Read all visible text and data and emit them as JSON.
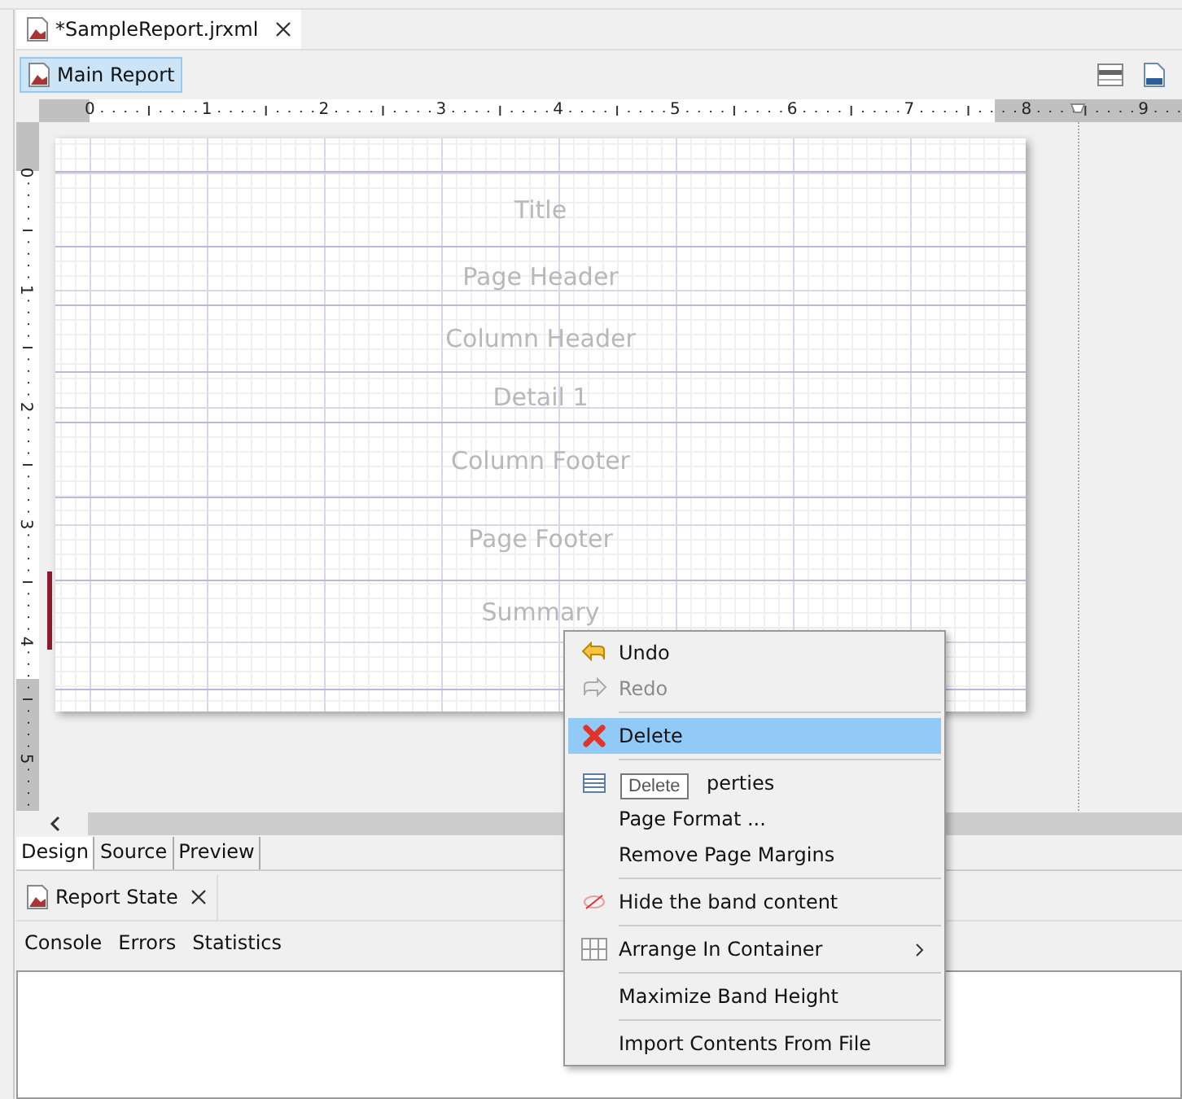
{
  "editor_tabs": [
    {
      "label": "*SampleReport.jrxml",
      "selected": true
    }
  ],
  "breadcrumb": {
    "label": "Main Report",
    "selected": true
  },
  "horizontal_ruler": {
    "labels": [
      "0",
      "1",
      "2",
      "3",
      "4",
      "5",
      "6",
      "7",
      "8",
      "9"
    ]
  },
  "vertical_ruler": {
    "labels": [
      "0",
      "1",
      "2",
      "3",
      "4",
      "5"
    ]
  },
  "bands": [
    {
      "name": "Title"
    },
    {
      "name": "Page Header"
    },
    {
      "name": "Column Header"
    },
    {
      "name": "Detail 1"
    },
    {
      "name": "Column Footer"
    },
    {
      "name": "Page Footer"
    },
    {
      "name": "Summary"
    }
  ],
  "view_tabs": [
    {
      "label": "Design",
      "selected": true
    },
    {
      "label": "Source",
      "selected": false
    },
    {
      "label": "Preview",
      "selected": false
    }
  ],
  "panel": {
    "tab": "Report State",
    "tabs": [
      "Console",
      "Errors",
      "Statistics"
    ]
  },
  "context_menu": {
    "tooltip": "Delete",
    "items": [
      {
        "kind": "item",
        "label": "Undo",
        "disabled": false,
        "selected": false
      },
      {
        "kind": "item",
        "label": "Redo",
        "disabled": true,
        "selected": false
      },
      {
        "kind": "separator"
      },
      {
        "kind": "item",
        "label": "Delete",
        "disabled": false,
        "selected": true
      },
      {
        "kind": "separator"
      },
      {
        "kind": "covered",
        "label": "perties",
        "disabled": false,
        "selected": false
      },
      {
        "kind": "item",
        "label": "Page Format ...",
        "disabled": false,
        "selected": false
      },
      {
        "kind": "item",
        "label": "Remove Page Margins",
        "disabled": false,
        "selected": false
      },
      {
        "kind": "separator"
      },
      {
        "kind": "item",
        "label": "Hide the band content",
        "disabled": false,
        "selected": false
      },
      {
        "kind": "separator"
      },
      {
        "kind": "submenu",
        "label": "Arrange In Container",
        "disabled": false,
        "selected": false
      },
      {
        "kind": "separator"
      },
      {
        "kind": "item",
        "label": "Maximize Band Height",
        "disabled": false,
        "selected": false
      },
      {
        "kind": "separator"
      },
      {
        "kind": "item",
        "label": "Import Contents From File",
        "disabled": false,
        "selected": false
      }
    ]
  }
}
